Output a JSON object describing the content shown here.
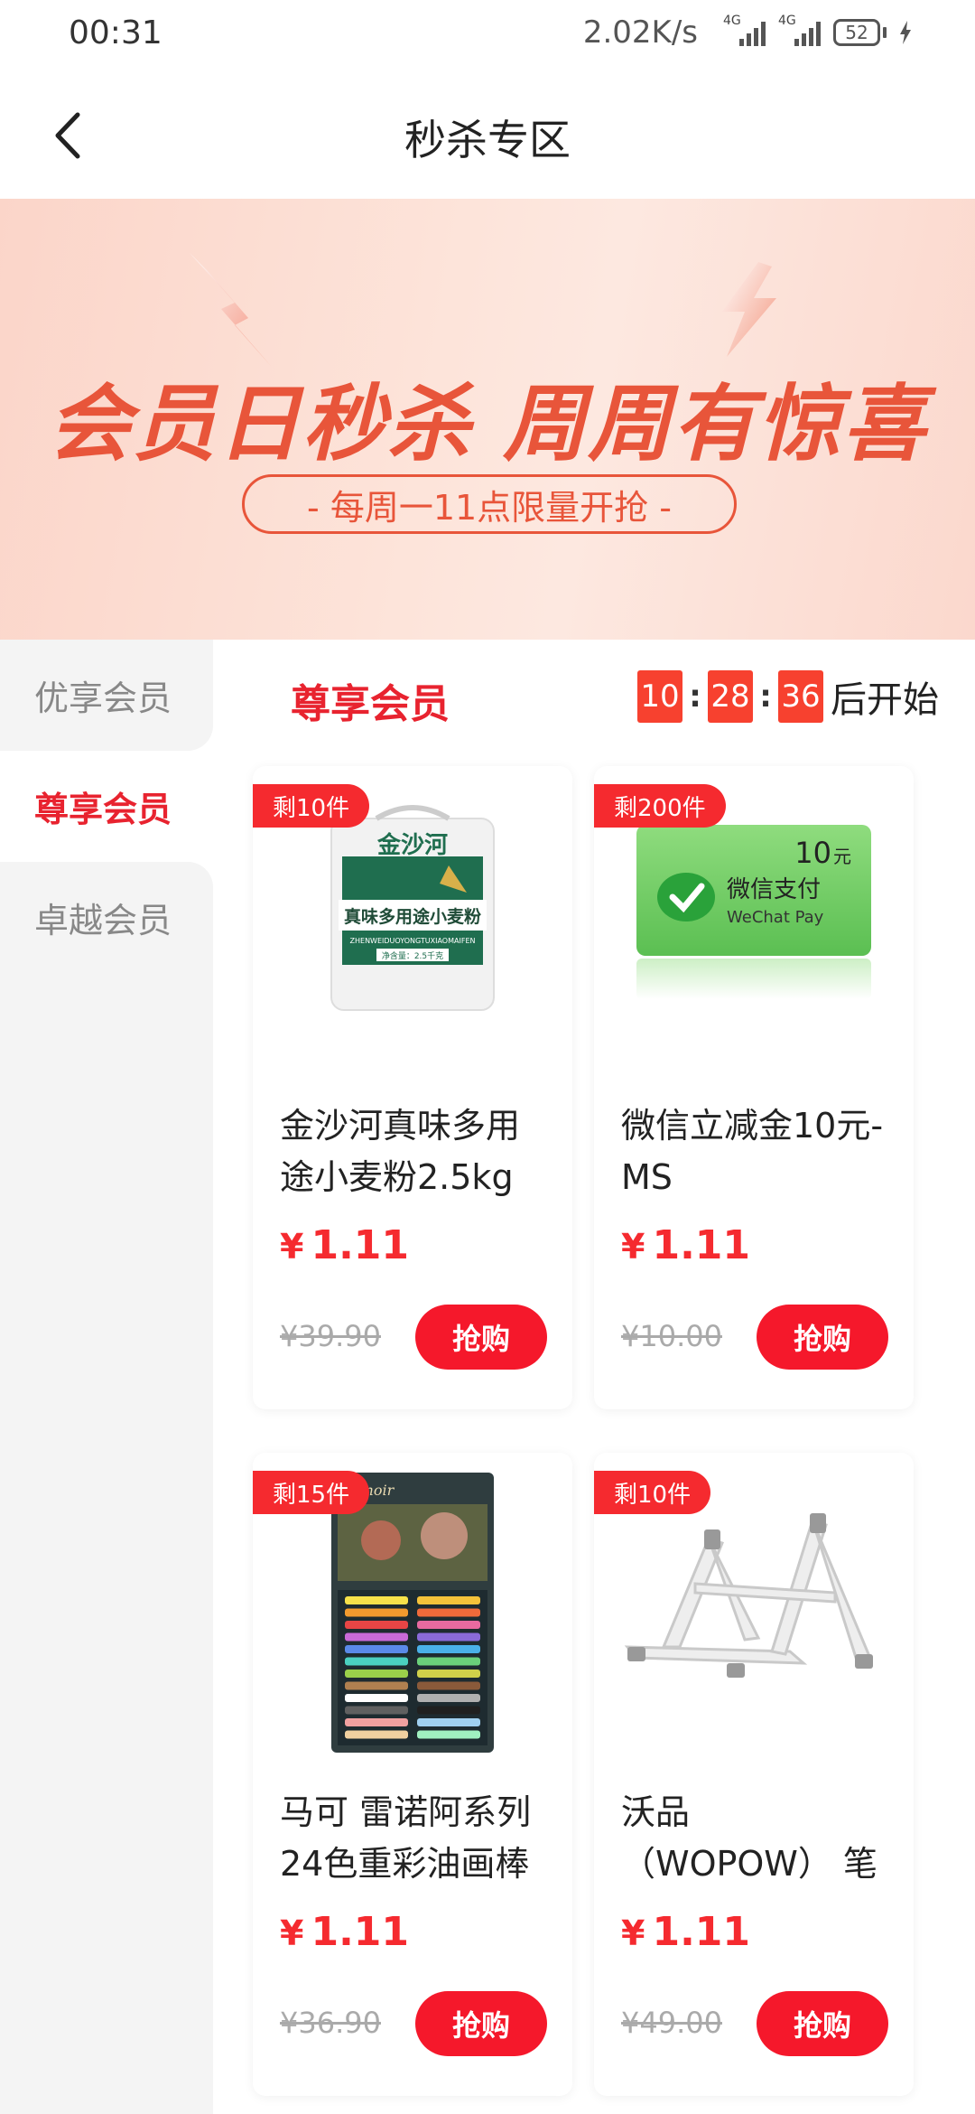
{
  "status_bar": {
    "time": "00:31",
    "net_speed": "2.02K/s",
    "signal1_label": "4G",
    "signal2_label": "4G",
    "battery": "52"
  },
  "header": {
    "title": "秒杀专区",
    "back_icon": "chevron-left-icon"
  },
  "banner": {
    "headline": "会员日秒杀  周周有惊喜",
    "subline": "- 每周一11点限量开抢 -"
  },
  "sidebar": {
    "items": [
      {
        "label": "优享会员",
        "active": false
      },
      {
        "label": "尊享会员",
        "active": true
      },
      {
        "label": "卓越会员",
        "active": false
      }
    ]
  },
  "section": {
    "title": "尊享会员",
    "countdown": {
      "hours": "10",
      "minutes": "28",
      "seconds": "36",
      "suffix": "后开始"
    }
  },
  "products": [
    {
      "stock": "剩10件",
      "name": "金沙河真味多用途小麦粉2.5kg",
      "currency": "¥",
      "price": "1.11",
      "orig_price": "¥39.90",
      "buy": "抢购",
      "image": "flour-bag-icon",
      "bag_brand": "金沙河",
      "bag_band": "真味多用途小麦粉",
      "bag_pinyin": "ZHENWEIDUOYONGTUXIAOMAIFEN",
      "bag_weight": "净含量：2.5千克"
    },
    {
      "stock": "剩200件",
      "name": "微信立减金10元-MS",
      "currency": "¥",
      "price": "1.11",
      "orig_price": "¥10.00",
      "buy": "抢购",
      "image": "wechat-pay-card-icon",
      "card_amount": "10",
      "card_unit": "元",
      "card_title": "微信支付",
      "card_subtitle": "WeChat Pay"
    },
    {
      "stock": "剩15件",
      "name": "马可 雷诺阿系列24色重彩油画棒",
      "currency": "¥",
      "price": "1.11",
      "orig_price": "¥36.90",
      "buy": "抢购",
      "image": "oil-pastel-box-icon",
      "box_brand": "Renoir"
    },
    {
      "stock": "剩10件",
      "name": "沃品（WOPOW） 笔记本支架",
      "currency": "¥",
      "price": "1.11",
      "orig_price": "¥49.00",
      "buy": "抢购",
      "image": "laptop-stand-icon"
    }
  ],
  "colors": {
    "accent": "#f52a2f",
    "banner_text": "#e8553a",
    "sidebar_bg": "#f4f4f4"
  }
}
